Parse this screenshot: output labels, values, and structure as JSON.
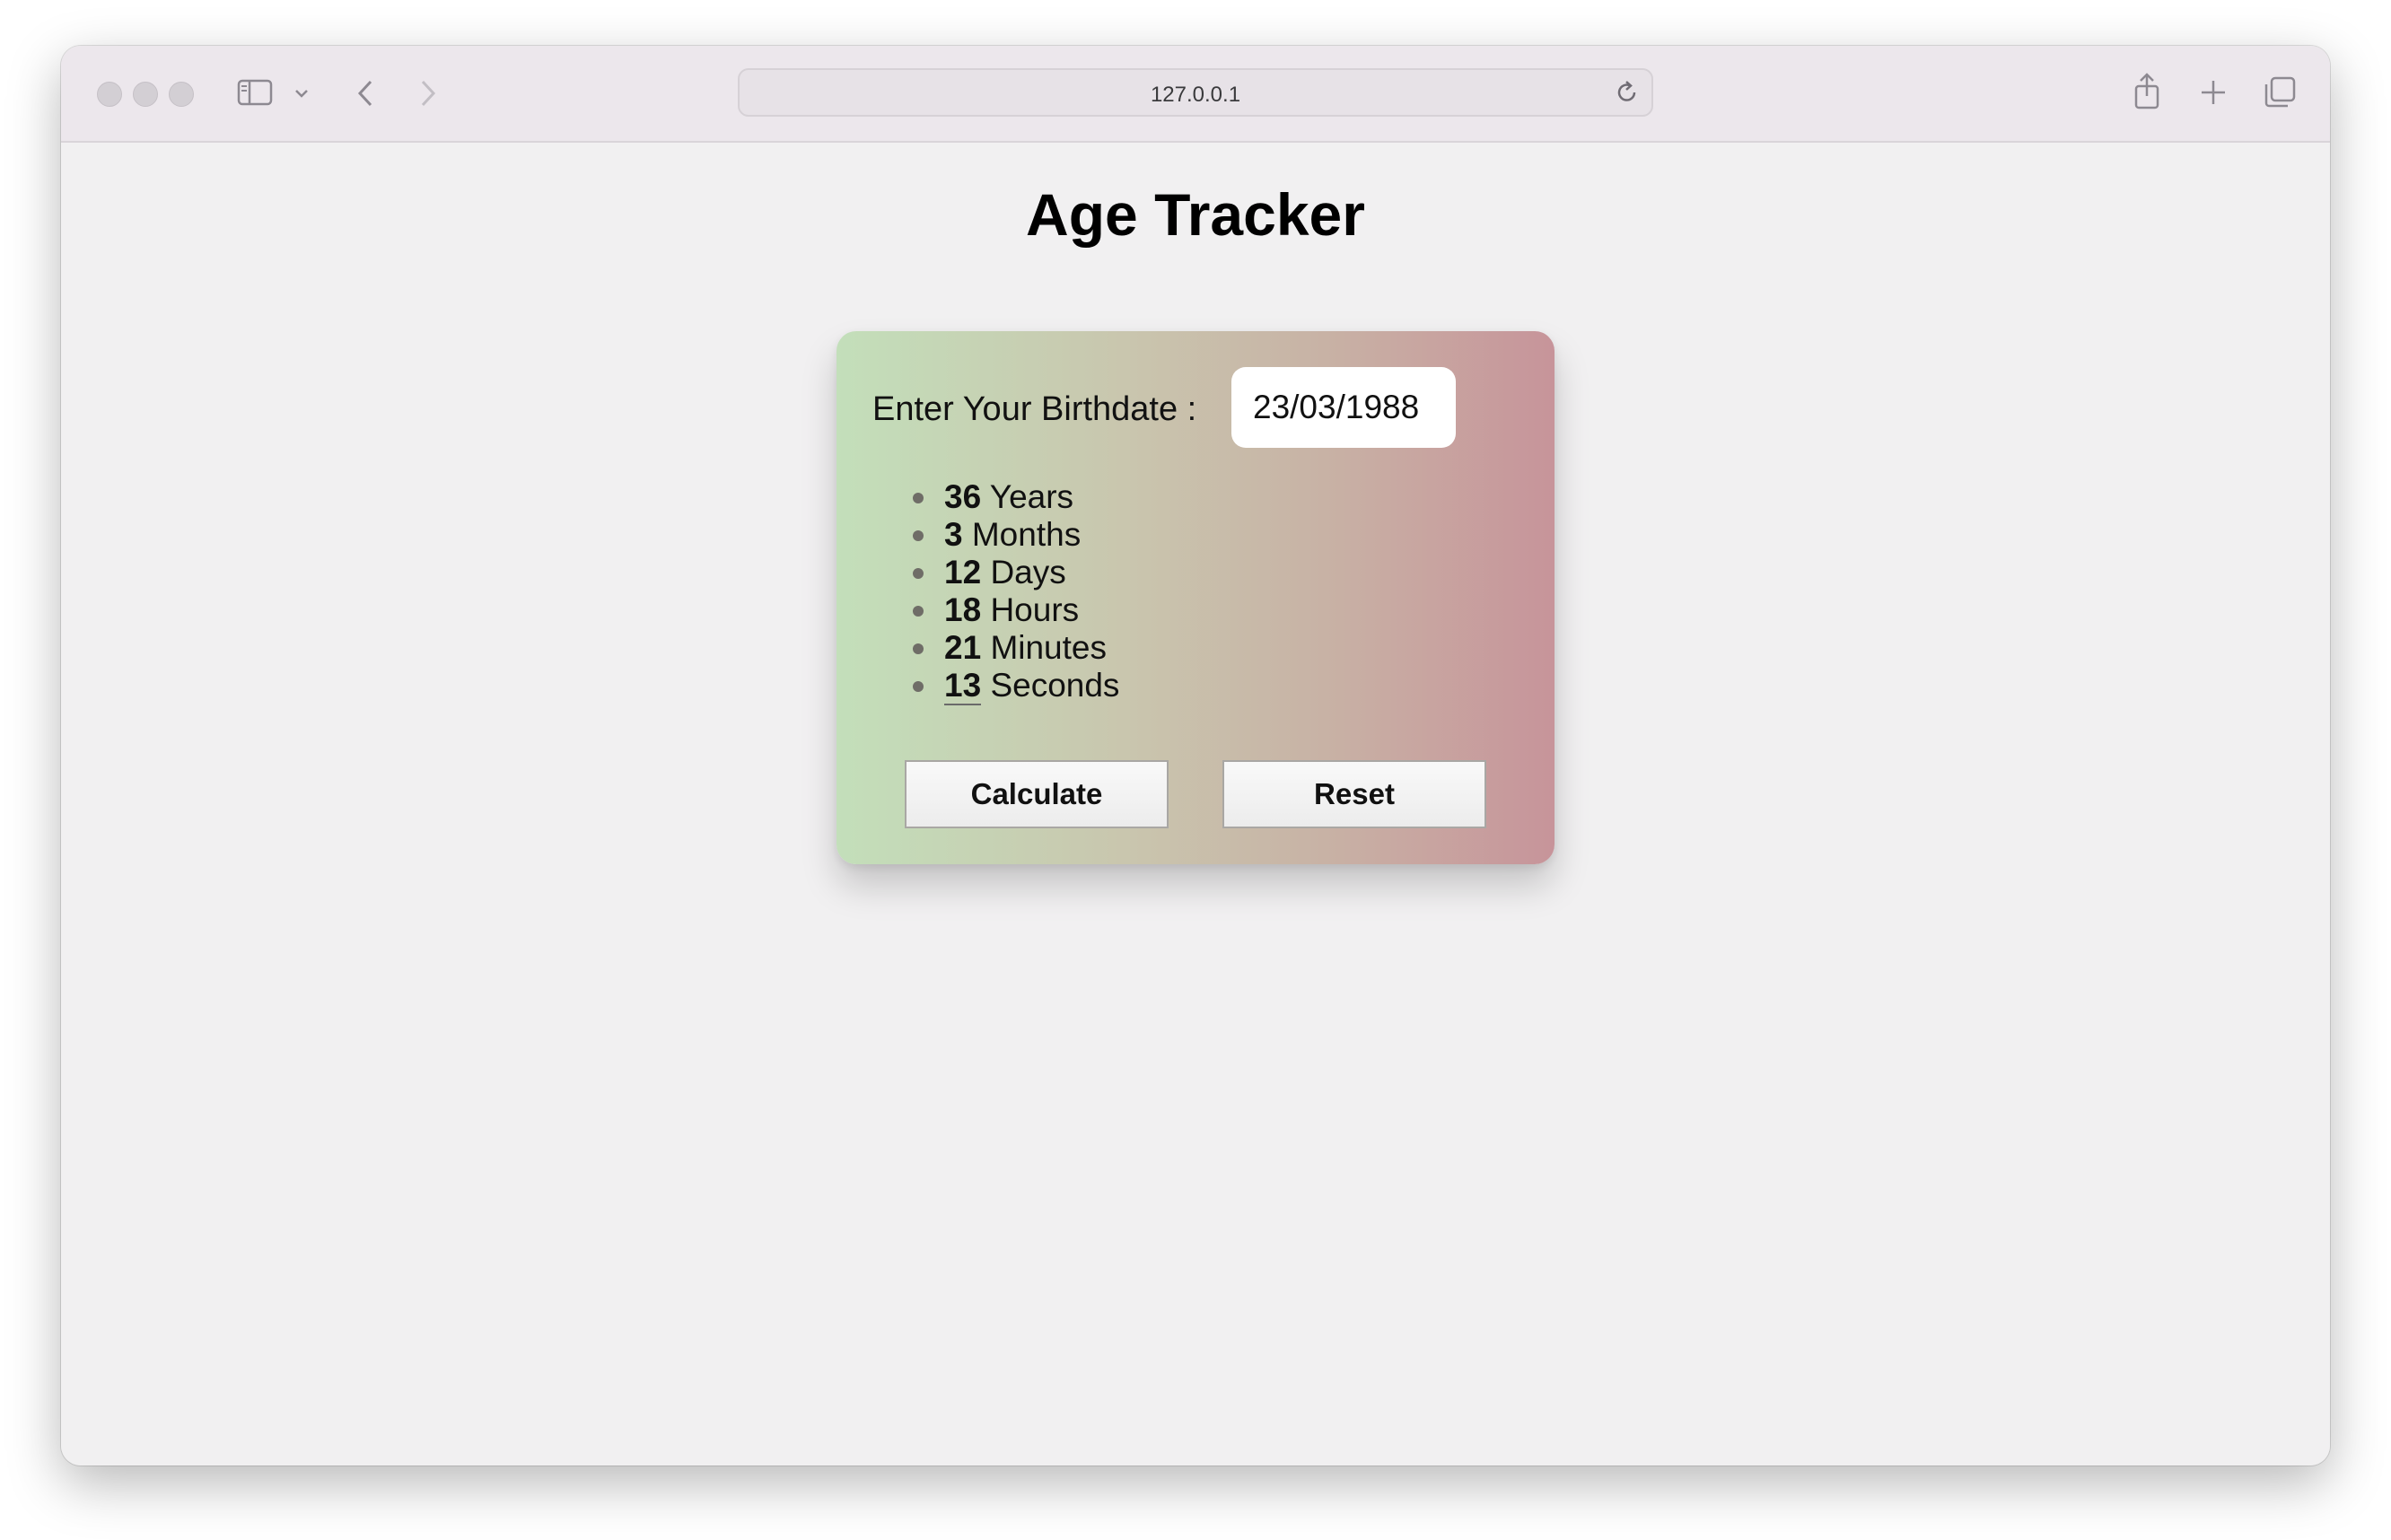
{
  "browser": {
    "address": "127.0.0.1",
    "icons": {
      "sidebar": "sidebar-icon",
      "dropdown": "chevron-down-icon",
      "back": "chevron-left-icon",
      "forward": "chevron-right-icon",
      "reload": "reload-icon",
      "share": "share-icon",
      "new_tab": "plus-icon",
      "tabs": "tabs-overview-icon"
    }
  },
  "page": {
    "title": "Age Tracker",
    "birthdate_label": "Enter Your Birthdate :",
    "birthdate_value": "23/03/1988",
    "results": [
      {
        "value": "36",
        "unit": "Years"
      },
      {
        "value": "3",
        "unit": "Months"
      },
      {
        "value": "12",
        "unit": "Days"
      },
      {
        "value": "18",
        "unit": "Hours"
      },
      {
        "value": "21",
        "unit": "Minutes"
      },
      {
        "value": "13",
        "unit": "Seconds"
      }
    ],
    "calculate_label": "Calculate",
    "reset_label": "Reset"
  },
  "colors": {
    "card_gradient_start": "#c3dfba",
    "card_gradient_end": "#c7949a",
    "page_background": "#f1f0f1"
  }
}
